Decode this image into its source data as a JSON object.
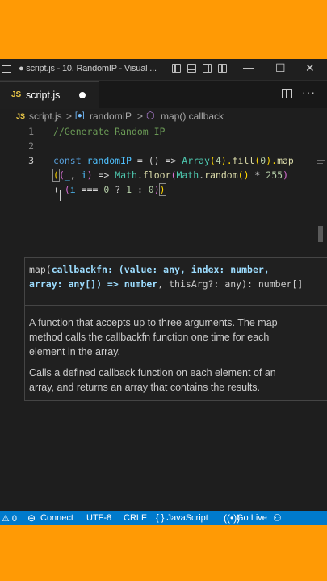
{
  "window": {
    "title": "● script.js - 10. RandomIP - Visual ...",
    "minimize_glyph": "—",
    "maximize_glyph": "☐",
    "close_glyph": "✕"
  },
  "tab": {
    "badge": "JS",
    "label": "script.js"
  },
  "breadcrumb": {
    "file_badge": "JS",
    "file": "script.js",
    "sep": ">",
    "variable_badge": "[●]",
    "variable": "randomIP",
    "callback_badge": "⬡",
    "callback": "map() callback"
  },
  "editor": {
    "line_numbers": [
      "1",
      "2",
      "3"
    ],
    "line1": {
      "slash": "/",
      "rest": "/Generate Random IP"
    },
    "line3a": {
      "kw": "const",
      "name": "randomIP",
      "eq": " = () => ",
      "cls": "Array",
      "p1": "(",
      "n4": "4",
      "p2": ").",
      "fill": "fill",
      "p3": "(",
      "n0": "0",
      "p4": ").",
      "map": "map"
    },
    "line3b": {
      "open": "(",
      "args_open": "(",
      "underscore": "_",
      "comma": ", ",
      "i": "i",
      "args_close": ")",
      "arrow": " => ",
      "math1": "Math",
      "dot1": ".",
      "floor": "floor",
      "p1": "(",
      "math2": "Math",
      "dot2": ".",
      "random": "random",
      "p2": "()",
      "times": " * ",
      "n255": "255",
      "p3": ")"
    },
    "line3c": {
      "plus": "+ ",
      "p1": "(",
      "i": "i",
      "eqeq": " === ",
      "n0": "0",
      "q": " ? ",
      "n1": "1",
      "colon": " : ",
      "n0b": "0",
      "p2": ")",
      "close": ")"
    }
  },
  "hover": {
    "sig_prefix": "map(",
    "sig_param": "callbackfn: (value: any, index: number, array: any[]) => number",
    "sig_rest": ", thisArg?: any): number[]",
    "desc1": "A function that accepts up to three arguments. The map method calls the callbackfn function one time for each element in the array.",
    "desc2": "Calls a defined callback function on each element of an array, and returns an array that contains the results."
  },
  "status": {
    "errors": "⚠ 0",
    "connect": "Connect",
    "encoding": "UTF-8",
    "eol": "CRLF",
    "language": "{ } JavaScript",
    "golive": "Go Live"
  },
  "colors": {
    "background": "#ff9a05",
    "statusbar": "#007acc",
    "editor": "#1e1e1e"
  },
  "icons": [
    "menu-icon",
    "layout-icon",
    "split-editor-icon",
    "more-actions-icon",
    "variable-icon",
    "method-icon",
    "broadcast-icon",
    "warning-icon"
  ]
}
